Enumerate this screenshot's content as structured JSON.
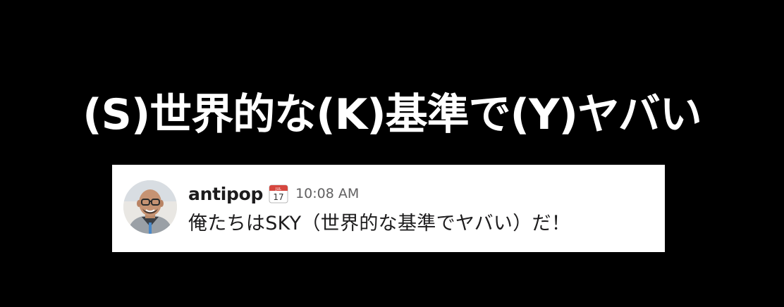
{
  "headline": "(S)世界的な(K)基準で(Y)ヤバい",
  "message": {
    "sender": "antipop",
    "status_icon": "calendar-icon",
    "calendar_month": "JUL",
    "calendar_day": "17",
    "timestamp": "10:08 AM",
    "text": "俺たちはSKY（世界的な基準でヤバい）だ！",
    "avatar_icon": "avatar-photo-icon"
  },
  "colors": {
    "background": "#000000",
    "headline": "#ffffff",
    "card": "#ffffff",
    "sender": "#1d1c1d",
    "timestamp": "#616061",
    "calendar_header": "#d6473f"
  }
}
